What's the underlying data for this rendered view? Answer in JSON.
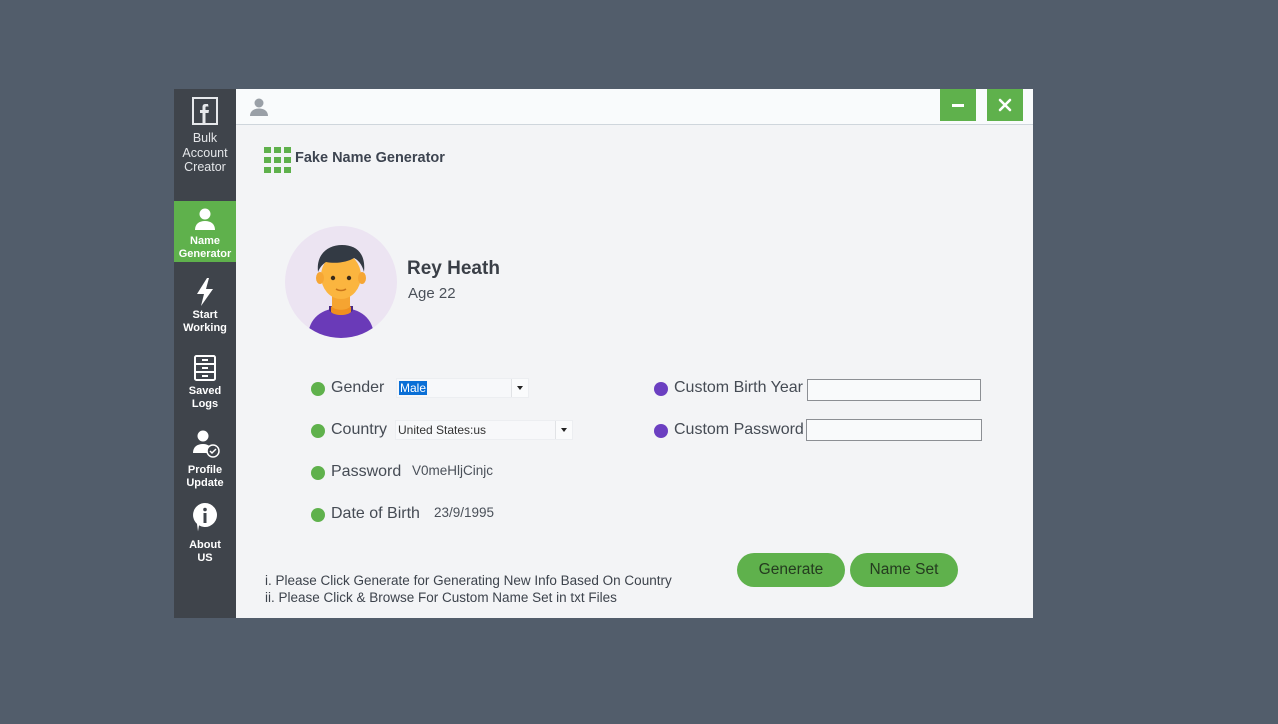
{
  "sidebar": {
    "brand_lines": [
      "Bulk",
      "Account",
      "Creator"
    ],
    "items": [
      {
        "lines": [
          "Name",
          "Generator"
        ],
        "active": true,
        "icon": "user-icon"
      },
      {
        "lines": [
          "Start",
          "Working"
        ],
        "active": false,
        "icon": "lightning-icon"
      },
      {
        "lines": [
          "Saved",
          "Logs"
        ],
        "active": false,
        "icon": "cabinet-icon"
      },
      {
        "lines": [
          "Profile",
          "Update"
        ],
        "active": false,
        "icon": "user-check-icon"
      },
      {
        "lines": [
          "About",
          "US"
        ],
        "active": false,
        "icon": "info-icon"
      }
    ]
  },
  "window_controls": {
    "minimize_icon": "minimize-icon",
    "close_icon": "close-icon"
  },
  "app": {
    "title": "Fake Name Generator",
    "title_icon": "grid-icon"
  },
  "profile": {
    "name": "Rey Heath",
    "age": "Age 22"
  },
  "fields": {
    "gender": {
      "label": "Gender",
      "value": "Male"
    },
    "country": {
      "label": "Country",
      "value": "United States:us"
    },
    "password": {
      "label": "Password",
      "value": "V0meHljCinjc"
    },
    "dob": {
      "label": "Date of Birth",
      "value": "23/9/1995"
    },
    "custom_birth_year": {
      "label": "Custom Birth Year",
      "value": ""
    },
    "custom_password": {
      "label": "Custom Password",
      "value": ""
    }
  },
  "buttons": {
    "generate": "Generate",
    "name_set": "Name Set"
  },
  "notes": [
    "i.  Please Click Generate for Generating New Info Based On Country",
    "ii. Please Click & Browse For Custom Name Set in txt  Files"
  ],
  "colors": {
    "accent": "#5fb14c",
    "purple": "#6b3fc1",
    "sidebar": "#3f444b",
    "background": "#525d6b"
  }
}
